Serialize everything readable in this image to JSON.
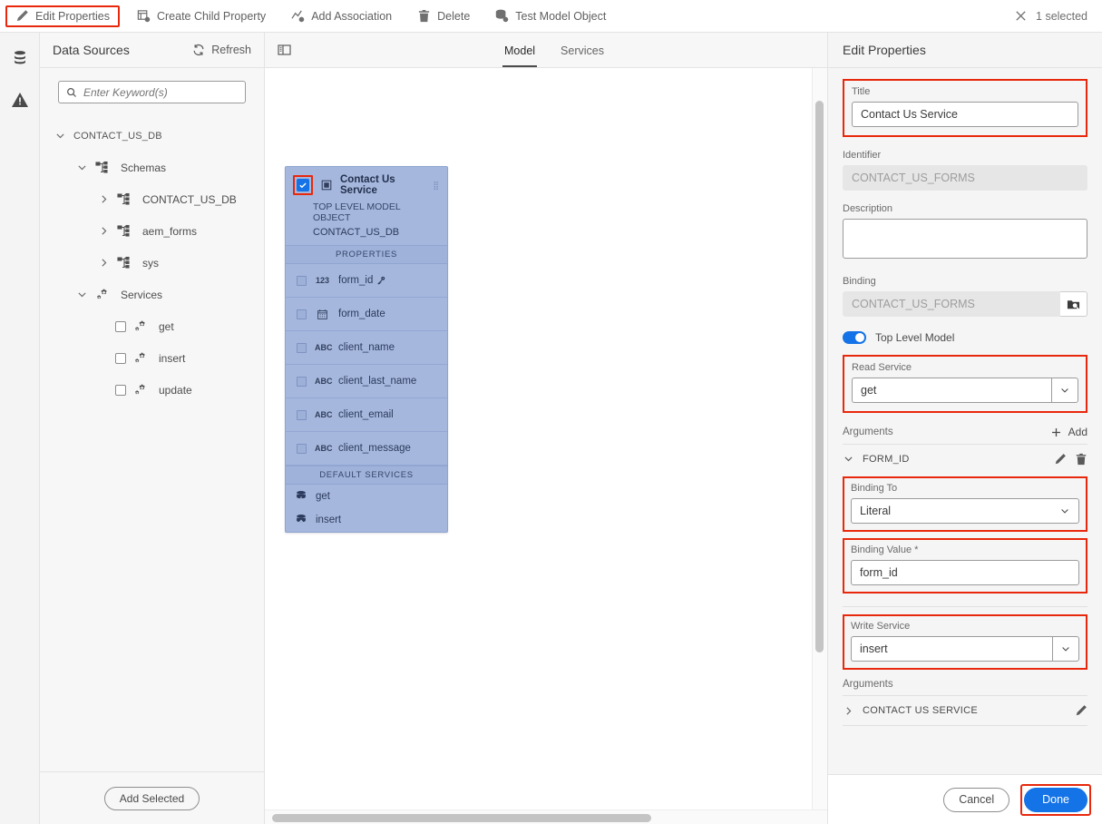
{
  "toolbar": {
    "items": [
      {
        "label": "Edit Properties",
        "icon": "pencil-icon",
        "highlighted": true
      },
      {
        "label": "Create Child Property",
        "icon": "create-child-property-icon",
        "highlighted": false
      },
      {
        "label": "Add Association",
        "icon": "add-association-icon",
        "highlighted": false
      },
      {
        "label": "Delete",
        "icon": "trash-icon",
        "highlighted": false
      },
      {
        "label": "Test Model Object",
        "icon": "test-model-object-icon",
        "highlighted": false
      }
    ],
    "selection_status": "1 selected",
    "close_icon": "close-icon"
  },
  "rail": {
    "items": [
      {
        "icon": "database-icon"
      },
      {
        "icon": "warning-triangle-icon"
      }
    ]
  },
  "data_sources": {
    "title": "Data Sources",
    "refresh_label": "Refresh",
    "refresh_icon": "refresh-icon",
    "search": {
      "placeholder": "Enter Keyword(s)",
      "value": "",
      "icon": "search-icon"
    },
    "tree": [
      {
        "label": "CONTACT_US_DB",
        "indent": 0,
        "caret": "down",
        "icon": null,
        "checkbox": false,
        "style": "small"
      },
      {
        "label": "Schemas",
        "indent": 1,
        "caret": "down",
        "icon": "schema-icon",
        "checkbox": false,
        "style": "normal"
      },
      {
        "label": "CONTACT_US_DB",
        "indent": 2,
        "caret": "right",
        "icon": "schema-icon",
        "checkbox": false,
        "style": "normal"
      },
      {
        "label": "aem_forms",
        "indent": 2,
        "caret": "right",
        "icon": "schema-icon",
        "checkbox": false,
        "style": "normal"
      },
      {
        "label": "sys",
        "indent": 2,
        "caret": "right",
        "icon": "schema-icon",
        "checkbox": false,
        "style": "normal"
      },
      {
        "label": "Services",
        "indent": 1,
        "caret": "down",
        "icon": "service-icon",
        "checkbox": false,
        "style": "normal"
      },
      {
        "label": "get",
        "indent": 2,
        "caret": "none",
        "icon": "service-icon",
        "checkbox": true,
        "style": "normal"
      },
      {
        "label": "insert",
        "indent": 2,
        "caret": "none",
        "icon": "service-icon",
        "checkbox": true,
        "style": "normal"
      },
      {
        "label": "update",
        "indent": 2,
        "caret": "none",
        "icon": "service-icon",
        "checkbox": true,
        "style": "normal"
      }
    ],
    "add_selected_label": "Add Selected"
  },
  "center": {
    "panel_toggle_icon": "panel-toggle-icon",
    "tabs": [
      {
        "label": "Model",
        "active": true
      },
      {
        "label": "Services",
        "active": false
      }
    ],
    "card": {
      "checked": true,
      "highlighted_checkbox": true,
      "title": "Contact Us Service",
      "object_icon": "model-object-icon",
      "grip_icon": "drag-grip-icon",
      "subtitle": "TOP LEVEL MODEL OBJECT",
      "source": "CONTACT_US_DB",
      "properties_header": "PROPERTIES",
      "properties": [
        {
          "name": "form_id",
          "type": "123",
          "type_icon": "number-icon",
          "key": true
        },
        {
          "name": "form_date",
          "type": "DATE",
          "type_icon": "calendar-icon",
          "key": false
        },
        {
          "name": "client_name",
          "type": "ABC",
          "type_icon": "text-icon",
          "key": false
        },
        {
          "name": "client_last_name",
          "type": "ABC",
          "type_icon": "text-icon",
          "key": false
        },
        {
          "name": "client_email",
          "type": "ABC",
          "type_icon": "text-icon",
          "key": false
        },
        {
          "name": "client_message",
          "type": "ABC",
          "type_icon": "text-icon",
          "key": false
        }
      ],
      "default_services_header": "DEFAULT SERVICES",
      "default_services": [
        {
          "label": "get",
          "icon": "read-service-icon"
        },
        {
          "label": "insert",
          "icon": "write-service-icon"
        }
      ]
    }
  },
  "edit_properties": {
    "heading": "Edit Properties",
    "title_label": "Title",
    "title_value": "Contact Us Service",
    "title_highlighted": true,
    "identifier_label": "Identifier",
    "identifier_value": "CONTACT_US_FORMS",
    "description_label": "Description",
    "description_value": "",
    "binding_label": "Binding",
    "binding_value": "CONTACT_US_FORMS",
    "binding_browse_icon": "browse-binding-icon",
    "top_level_model_label": "Top Level Model",
    "top_level_model_on": true,
    "read_service_label": "Read Service",
    "read_service_value": "get",
    "read_service_highlighted": true,
    "read_arguments_label": "Arguments",
    "add_label": "Add",
    "add_icon": "plus-icon",
    "argument_name": "FORM_ID",
    "argument_edit_icon": "pencil-icon",
    "argument_delete_icon": "trash-icon",
    "binding_to_label": "Binding To",
    "binding_to_value": "Literal",
    "binding_to_highlighted": true,
    "binding_value_label": "Binding Value *",
    "binding_value_value": "form_id",
    "binding_value_highlighted": true,
    "write_service_label": "Write Service",
    "write_service_value": "insert",
    "write_service_highlighted": true,
    "write_arguments_label": "Arguments",
    "write_argument_name": "CONTACT US SERVICE",
    "write_argument_edit_icon": "pencil-icon",
    "cancel_label": "Cancel",
    "done_label": "Done",
    "done_highlighted": true
  },
  "colors": {
    "accent": "#1473e6",
    "highlight": "#e8280c",
    "card_bg": "#a5b7dd",
    "panel_bg": "#f5f5f5"
  }
}
